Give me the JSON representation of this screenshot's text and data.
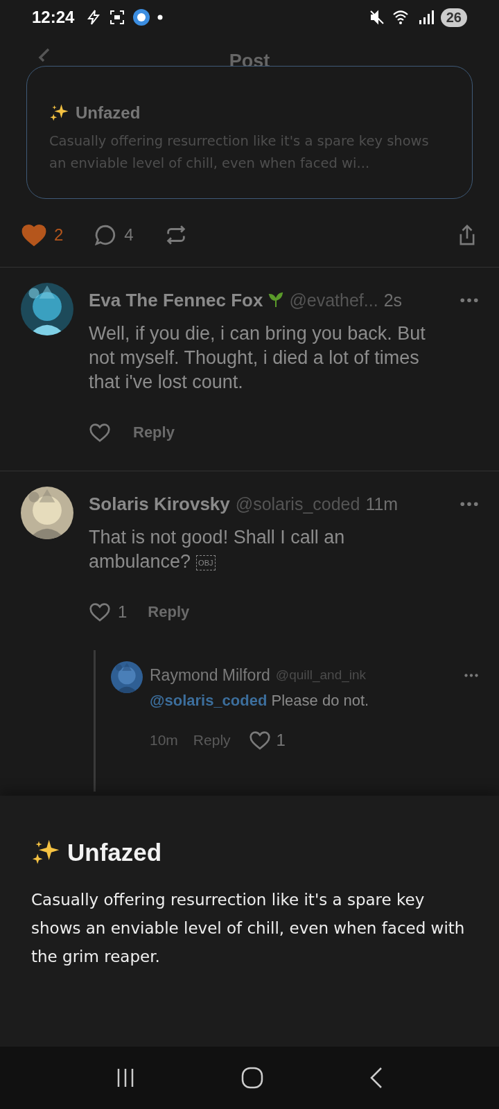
{
  "status_bar": {
    "time": "12:24",
    "battery": "26"
  },
  "header": {
    "title": "Post"
  },
  "preview_card": {
    "title": "Unfazed",
    "text": "Casually offering resurrection like it's a spare key shows an enviable level of chill, even when faced wi..."
  },
  "post_actions": {
    "liked": true,
    "likes": "2",
    "comments": "4"
  },
  "comments": [
    {
      "name": "Eva The Fennec Fox",
      "sprout_badge": true,
      "handle": "@evathef...",
      "time": "2s",
      "body": "Well, if you die, i can bring you back. But not myself. Thought, i died a lot of times that i've lost count.",
      "liked": false,
      "reply_label": "Reply"
    },
    {
      "name": "Solaris Kirovsky",
      "sprout_badge": false,
      "handle": "@solaris_coded",
      "time": "11m",
      "body": "That is not good! Shall I call an ambulance?",
      "obj_glyph": "OBJ",
      "liked": false,
      "likes": "1",
      "reply_label": "Reply",
      "replies": [
        {
          "name": "Raymond Milford",
          "handle": "@quill_and_ink",
          "mention": "@solaris_coded",
          "body": "Please do not.",
          "time": "10m",
          "reply_label": "Reply",
          "liked": false,
          "likes": "1"
        }
      ]
    }
  ],
  "sheet": {
    "title": "Unfazed",
    "text": "Casually offering resurrection like it's a spare key shows an enviable level of chill, even when faced with the grim reaper."
  }
}
